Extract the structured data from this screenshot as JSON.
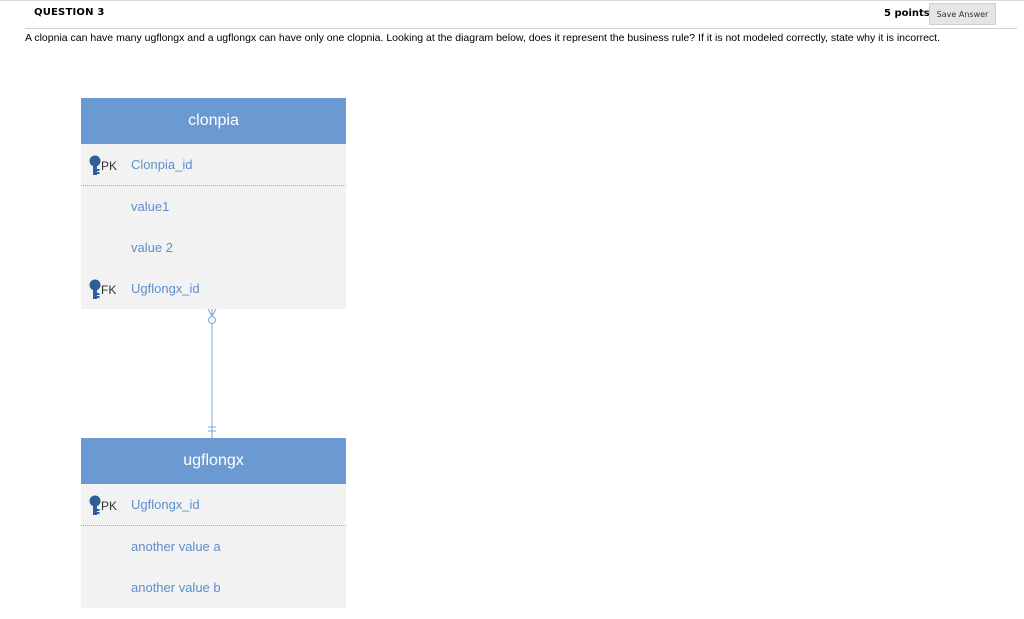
{
  "header": {
    "question_label": "QUESTION 3",
    "points": "5 points",
    "save_label": "Save Answer"
  },
  "question": {
    "text": "A clopnia can have many ugflongx and a ugflongx can have only one clopnia. Looking at the diagram below, does it represent the business rule?  If it is not modeled correctly, state why it is incorrect."
  },
  "diagram": {
    "entity1": {
      "name": "clonpia",
      "pk_tag": "PK",
      "pk_field": "Clonpia_id",
      "field1": "value1",
      "field2": "value 2",
      "fk_tag": "FK",
      "fk_field": "Ugflongx_id"
    },
    "entity2": {
      "name": "ugflongx",
      "pk_tag": "PK",
      "pk_field": "Ugflongx_id",
      "field1": "another value a",
      "field2": "another value b"
    },
    "colors": {
      "header": "#6b9ad2",
      "body": "#f2f2f2",
      "field_text": "#5e8fcc",
      "line": "#7aa7dc",
      "key_icon": "#2f5f98"
    },
    "relationship": {
      "top_end": "zero-or-many",
      "bottom_end": "exactly-one"
    }
  }
}
